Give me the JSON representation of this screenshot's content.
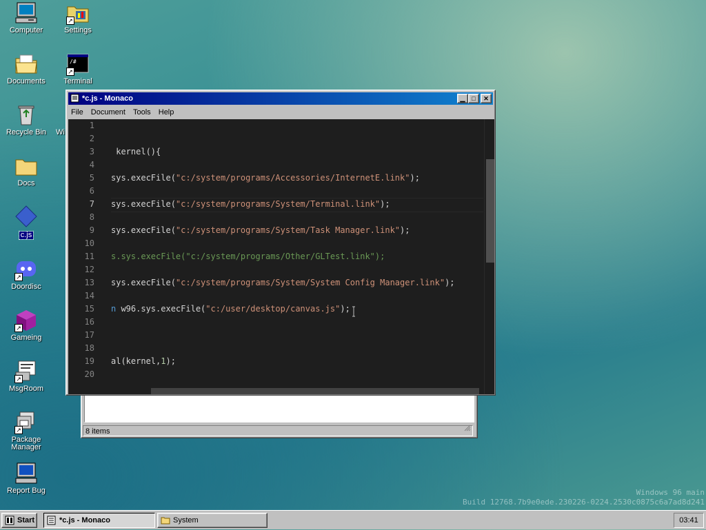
{
  "desktop": {
    "icons": [
      {
        "label": "Computer"
      },
      {
        "label": "Settings"
      },
      {
        "label": "Documents"
      },
      {
        "label": "Terminal"
      },
      {
        "label": "Recycle Bin"
      },
      {
        "label": "Docs"
      },
      {
        "label": "c.js"
      },
      {
        "label": "Doordisc"
      },
      {
        "label": "Gameing"
      },
      {
        "label": "MsgRoom"
      },
      {
        "label": "Package Manager"
      },
      {
        "label": "Report Bug"
      }
    ],
    "hidden_label": "Wi"
  },
  "editor_window": {
    "title": "*c.js - Monaco",
    "menu": [
      "File",
      "Document",
      "Tools",
      "Help"
    ],
    "line_numbers": [
      "1",
      "2",
      "3",
      "4",
      "5",
      "6",
      "7",
      "8",
      "9",
      "10",
      "11",
      "12",
      "13",
      "14",
      "15",
      "16",
      "17",
      "18",
      "19",
      "20"
    ],
    "code": {
      "l3": " kernel(){",
      "l5a": "sys.execFile(",
      "l5b": "\"c:/system/programs/Accessories/InternetE.link\"",
      "l5c": ");",
      "l7a": "sys.execFile(",
      "l7b": "\"c:/system/programs/System/Terminal.link\"",
      "l7c": ");",
      "l9a": "sys.execFile(",
      "l9b": "\"c:/system/programs/System/Task Manager.link\"",
      "l9c": ");",
      "l11": "s.sys.execFile(\"c:/system/programs/Other/GLTest.link\");",
      "l13a": "sys.execFile(",
      "l13b": "\"c:/system/programs/System/System Config Manager.link\"",
      "l13c": ");",
      "l15a": "n",
      "l15b": " w96.sys.execFile(",
      "l15c": "\"c:/user/desktop/canvas.js\"",
      "l15d": ");",
      "l19a": "al(kernel,",
      "l19b": "1",
      "l19c": ");"
    },
    "colors": {
      "background": "#1e1e1e",
      "string": "#ce9178",
      "number": "#b5cea8",
      "keyword": "#569cd6"
    }
  },
  "explorer_window": {
    "status": "8 items"
  },
  "taskbar": {
    "start_label": "Start",
    "tasks": [
      {
        "label": "*c.js - Monaco",
        "active": true
      },
      {
        "label": "System",
        "active": false
      }
    ],
    "clock": "03:41"
  },
  "watermark": {
    "line1": "Windows 96 main",
    "line2": "Build 12768.7b9e0ede.230226-0224.2530c0875c6a7ad8d241"
  }
}
